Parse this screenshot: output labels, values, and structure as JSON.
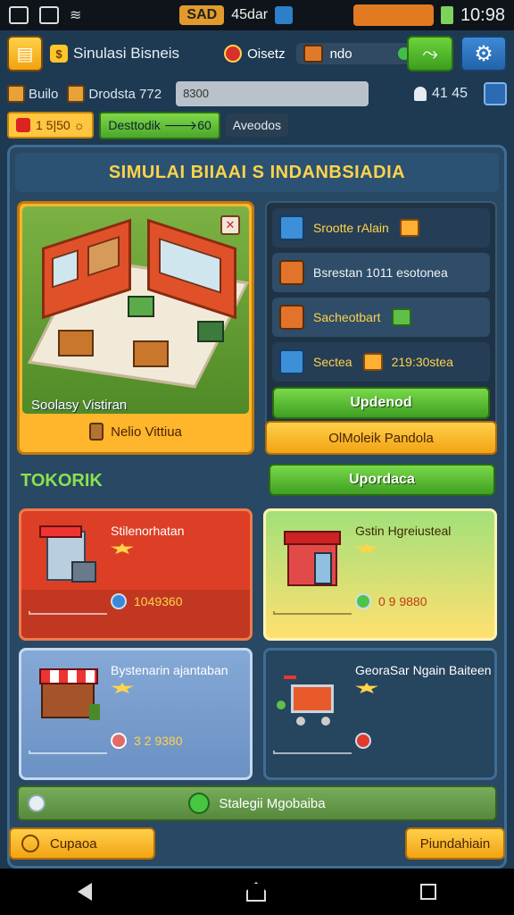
{
  "status": {
    "pill_left": "SAD",
    "pill_mid": "45dar",
    "time": "10:98"
  },
  "topbar": {
    "title": "Sinulasi Bisneis",
    "cash_label": "Oisetz",
    "cash_value": "ndo"
  },
  "resources": {
    "item1": "Builo",
    "item2": "Drodsta 772",
    "progress_text": "8300",
    "people": "41 45"
  },
  "badges": {
    "orange": "1 5|50 ☼",
    "green": "Desttodik 🡒60",
    "dark": "Aveodos"
  },
  "panel": {
    "title": "SIMULAI BIIAAI S INDANBSIADIA",
    "hero_caption": "Soolasy Vistiran",
    "hero_button": "Nelio Vittiua",
    "side_rows": [
      {
        "label": "Srootte rAlain"
      },
      {
        "label": "Bsrestan 1011 esotonea"
      },
      {
        "label": "Sacheotbart"
      },
      {
        "label": "Sectea",
        "extra": "219:30stea"
      }
    ],
    "side_green_btn": "Updenod",
    "side_orange_btn": "OlMoleik Pandola",
    "section_label": "TOKORIK",
    "section_btn": "Upordaca"
  },
  "cards": [
    {
      "name": "Stilenorhatan",
      "value": "1049360"
    },
    {
      "name": "Gstin Hgreiusteal",
      "value": "0   9 9880"
    },
    {
      "name": "Bystenarin ajantaban",
      "value": "3   2 9380"
    },
    {
      "name": "GeoraSar Ngain Baiteen",
      "value": ""
    }
  ],
  "bottom": {
    "wide_btn": "Stalegii Mgobaiba",
    "left_btn": "Cupaoa",
    "right_btn": "Piundahiain"
  }
}
